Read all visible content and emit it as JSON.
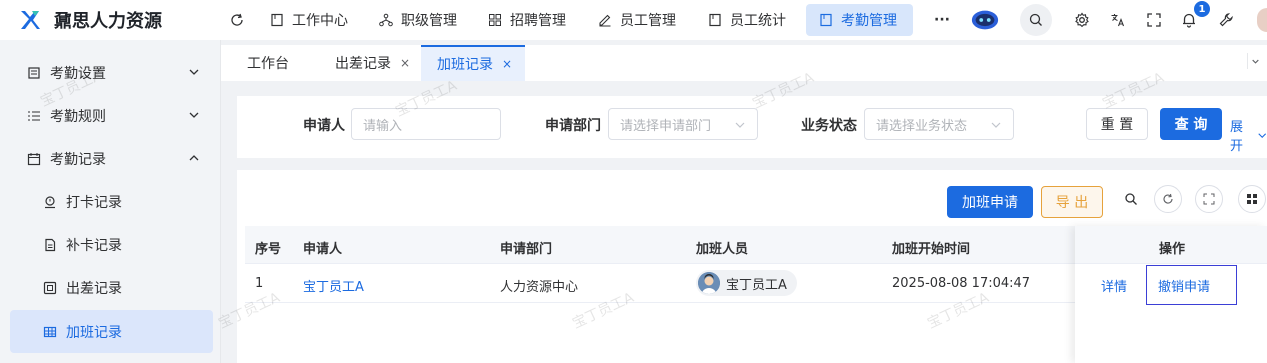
{
  "app": {
    "title": "鼐思人力资源"
  },
  "sidebar": {
    "items": [
      {
        "label": "考勤设置"
      },
      {
        "label": "考勤规则"
      },
      {
        "label": "考勤记录"
      },
      {
        "label": "打卡记录"
      },
      {
        "label": "补卡记录"
      },
      {
        "label": "出差记录"
      },
      {
        "label": "加班记录"
      }
    ]
  },
  "topnav": {
    "items": [
      {
        "label": "工作中心"
      },
      {
        "label": "职级管理"
      },
      {
        "label": "招聘管理"
      },
      {
        "label": "员工管理"
      },
      {
        "label": "员工统计"
      },
      {
        "label": "考勤管理"
      }
    ],
    "more": "···",
    "notification_count": "1"
  },
  "tabs": {
    "items": [
      {
        "label": "工作台"
      },
      {
        "label": "出差记录",
        "close": "×"
      },
      {
        "label": "加班记录",
        "close": "×"
      }
    ]
  },
  "filter": {
    "applicant_label": "申请人",
    "applicant_placeholder": "请输入",
    "dept_label": "申请部门",
    "dept_placeholder": "请选择申请部门",
    "status_label": "业务状态",
    "status_placeholder": "请选择业务状态",
    "reset": "重 置",
    "search": "查 询",
    "expand": "展开"
  },
  "toolbar": {
    "apply": "加班申请",
    "export": "导 出"
  },
  "table": {
    "headers": [
      "序号",
      "申请人",
      "申请部门",
      "加班人员",
      "加班开始时间",
      "操作"
    ],
    "rows": [
      {
        "index": "1",
        "applicant": "宝丁员工A",
        "dept": "人力资源中心",
        "person": "宝丁员工A",
        "start": "2025-08-08 17:04:47",
        "detail": "详情",
        "revoke": "撤销申请"
      }
    ]
  },
  "watermark": "宝丁员工A",
  "colors": {
    "primary": "#1c6be0",
    "warning": "#e6a23c",
    "sidebar_bg": "#f2f4f7"
  }
}
